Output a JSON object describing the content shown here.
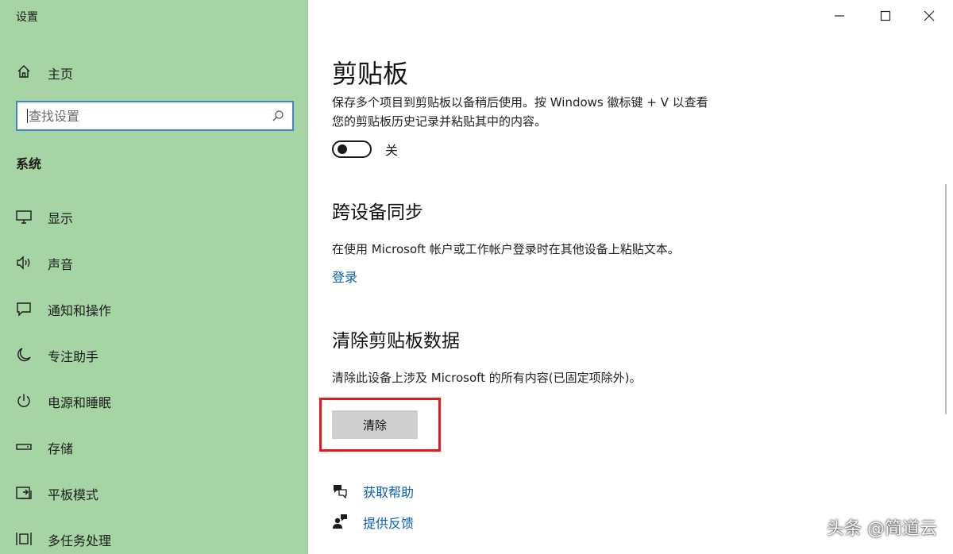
{
  "window": {
    "app_title": "设置",
    "controls": [
      "minimize",
      "maximize",
      "close"
    ]
  },
  "sidebar": {
    "home_label": "主页",
    "search_placeholder": "查找设置",
    "section_label": "系统",
    "items": [
      {
        "label": "显示",
        "icon": "monitor-icon"
      },
      {
        "label": "声音",
        "icon": "speaker-icon"
      },
      {
        "label": "通知和操作",
        "icon": "notification-icon"
      },
      {
        "label": "专注助手",
        "icon": "moon-icon"
      },
      {
        "label": "电源和睡眠",
        "icon": "power-icon"
      },
      {
        "label": "存储",
        "icon": "storage-icon"
      },
      {
        "label": "平板模式",
        "icon": "tablet-icon"
      },
      {
        "label": "多任务处理",
        "icon": "multitask-icon"
      }
    ]
  },
  "main": {
    "title": "剪贴板",
    "history_desc_line1": "保存多个项目到剪贴板以备稍后使用。按 Windows 徽标键 + V 以查看",
    "history_desc_line2": "您的剪贴板历史记录并粘贴其中的内容。",
    "toggle": {
      "state": "off",
      "label": "关"
    },
    "sync": {
      "title": "跨设备同步",
      "desc": "在使用 Microsoft 帐户或工作帐户登录时在其他设备上粘贴文本。",
      "link": "登录"
    },
    "clear": {
      "title": "清除剪贴板数据",
      "desc": "清除此设备上涉及 Microsoft 的所有内容(已固定项除外)。",
      "button": "清除"
    },
    "help": {
      "get_help": "获取帮助",
      "feedback": "提供反馈"
    },
    "highlight_color": "#e21c1c",
    "link_color": "#0a5fb0"
  },
  "watermark": "头条 @简道云",
  "colors": {
    "sidebar_bg": "#a6d4a5",
    "search_border": "#3f86c8",
    "button_bg": "#cfcfcf"
  }
}
